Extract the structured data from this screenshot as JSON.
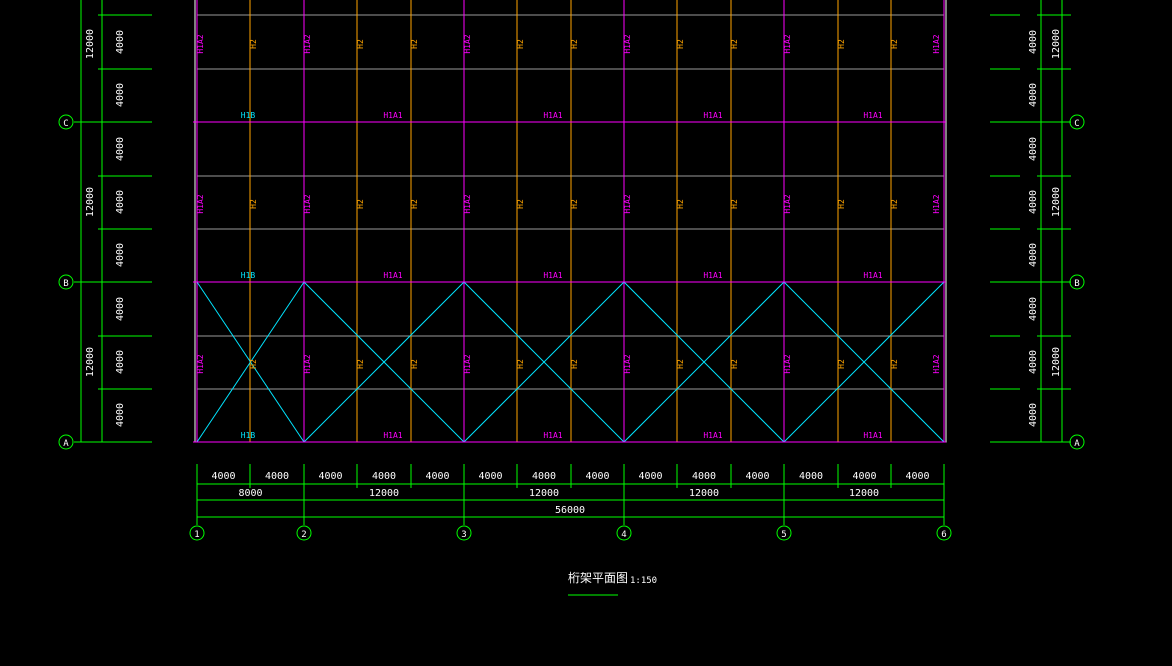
{
  "drawing": {
    "title": "桁架平面图",
    "scale": "1:150"
  },
  "colors": {
    "background": "#000000",
    "grid": "#00ff00",
    "axis_bubble": "#00ff00",
    "truss_h1a2": "#ff00ff",
    "truss_h2": "#ffa500",
    "bracing": "#00e5ff",
    "purlin": "#9a9a9a",
    "dims": "#00ff00",
    "text": "#ffffff"
  },
  "axes": {
    "columns": [
      "1",
      "2",
      "3",
      "4",
      "5",
      "6"
    ],
    "rows": [
      "C",
      "B",
      "A"
    ]
  },
  "dimensions": {
    "sub_spans": [
      "4000",
      "4000",
      "4000",
      "4000",
      "4000",
      "4000",
      "4000",
      "4000",
      "4000",
      "4000",
      "4000",
      "4000",
      "4000",
      "4000"
    ],
    "bays": [
      "8000",
      "12000",
      "12000",
      "12000",
      "12000"
    ],
    "total": "56000",
    "left_outer": [
      "12000",
      "12000",
      "12000"
    ],
    "left_inner": [
      "4000",
      "4000",
      "4000",
      "4000",
      "4000",
      "4000",
      "4000",
      "4000"
    ],
    "right_outer": [
      "12000",
      "12000",
      "12000"
    ],
    "right_inner": [
      "4000",
      "4000",
      "4000",
      "4000",
      "4000",
      "4000",
      "4000",
      "4000"
    ]
  },
  "labels": {
    "h1a2": "H1A2",
    "h2": "H2",
    "h1a1": "H1A1",
    "h1b": "H1B"
  }
}
